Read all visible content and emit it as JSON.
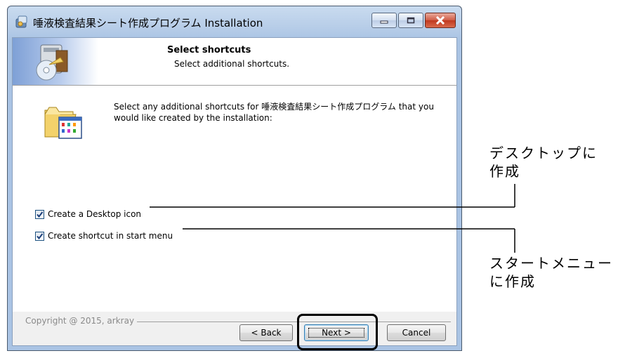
{
  "window": {
    "title": "唾液検査結果シート作成プログラム Installation",
    "caption_buttons": [
      "minimize-icon",
      "maximize-icon",
      "close-icon"
    ]
  },
  "header": {
    "title": "Select shortcuts",
    "subtitle": "Select additional shortcuts."
  },
  "body": {
    "description": "Select any additional shortcuts for 唾液検査結果シート作成プログラム that you would like created by the installation:",
    "options": [
      {
        "label": "Create a Desktop icon",
        "checked": true
      },
      {
        "label": "Create shortcut in start menu",
        "checked": true
      }
    ]
  },
  "footer": {
    "copyright": "Copyright @ 2015, arkray",
    "back_label": "< Back",
    "next_label": "Next >",
    "cancel_label": "Cancel"
  },
  "annotations": {
    "desktop_line1": "デスクトップに",
    "desktop_line2": "作成",
    "startmenu_line1": "スタートメニュー",
    "startmenu_line2": "に作成"
  },
  "colors": {
    "accent": "#3c7fb1",
    "close_button": "#c0381e",
    "titlebar": "#b7cde8"
  }
}
